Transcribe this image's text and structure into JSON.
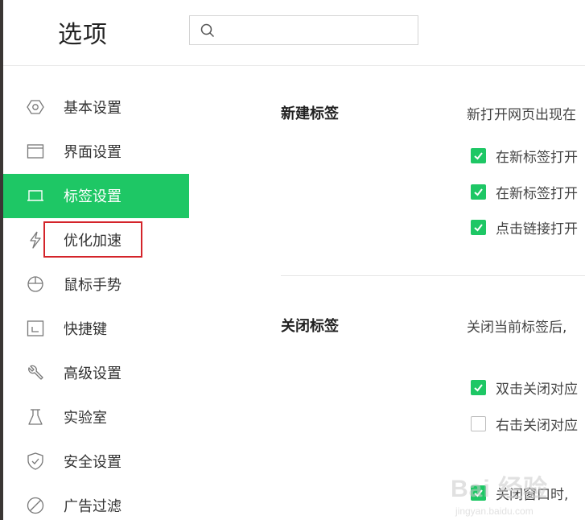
{
  "window": {
    "title": "选项"
  },
  "search": {
    "placeholder": "",
    "value": ""
  },
  "sidebar": {
    "items": [
      {
        "id": "basic",
        "label": "基本设置",
        "icon": "hexagon-settings-icon",
        "active": false
      },
      {
        "id": "interface",
        "label": "界面设置",
        "icon": "window-icon",
        "active": false
      },
      {
        "id": "tabs",
        "label": "标签设置",
        "icon": "tab-icon",
        "active": true
      },
      {
        "id": "optimize",
        "label": "优化加速",
        "icon": "lightning-icon",
        "active": false
      },
      {
        "id": "mouse",
        "label": "鼠标手势",
        "icon": "mouse-icon",
        "active": false
      },
      {
        "id": "shortcuts",
        "label": "快捷键",
        "icon": "keyboard-shortcut-icon",
        "active": false
      },
      {
        "id": "advanced",
        "label": "高级设置",
        "icon": "wrench-icon",
        "active": false
      },
      {
        "id": "lab",
        "label": "实验室",
        "icon": "flask-icon",
        "active": false
      },
      {
        "id": "security",
        "label": "安全设置",
        "icon": "shield-icon",
        "active": false
      },
      {
        "id": "adblock",
        "label": "广告过滤",
        "icon": "block-icon",
        "active": false
      }
    ]
  },
  "main": {
    "new_tab": {
      "title": "新建标签",
      "desc": "新打开网页出现在",
      "options": [
        {
          "label": "在新标签打开",
          "checked": true
        },
        {
          "label": "在新标签打开",
          "checked": true
        },
        {
          "label": "点击链接打开",
          "checked": true
        }
      ]
    },
    "close_tab": {
      "title": "关闭标签",
      "desc": "关闭当前标签后,",
      "options": [
        {
          "label": "双击关闭对应",
          "checked": true
        },
        {
          "label": "右击关闭对应",
          "checked": false
        },
        {
          "label": "关闭窗口时,",
          "checked": true
        }
      ]
    }
  },
  "watermark": {
    "text": "Bai 经验",
    "sub": "jingyan.baidu.com"
  },
  "colors": {
    "accent": "#1ec765",
    "highlight": "#d4242a"
  }
}
